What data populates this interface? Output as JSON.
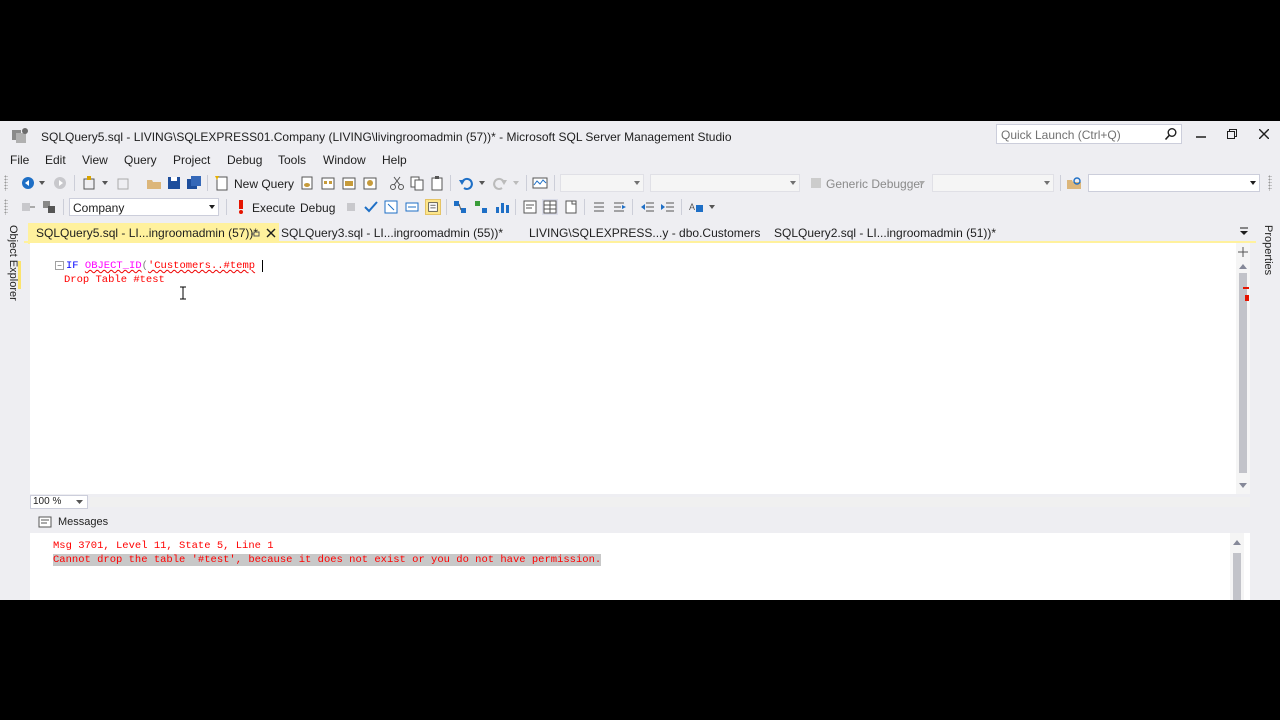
{
  "window": {
    "title": "SQLQuery5.sql - LIVING\\SQLEXPRESS01.Company (LIVING\\livingroomadmin (57))* - Microsoft SQL Server Management Studio",
    "quick_launch_placeholder": "Quick Launch (Ctrl+Q)"
  },
  "menu": [
    "File",
    "Edit",
    "View",
    "Query",
    "Project",
    "Debug",
    "Tools",
    "Window",
    "Help"
  ],
  "toolbar1": {
    "new_query_label": "New Query",
    "debugger_label": "Generic Debugger"
  },
  "toolbar2": {
    "database": "Company",
    "execute_label": "Execute",
    "debug_label": "Debug"
  },
  "side": {
    "left_tab": "Object Explorer",
    "right_tab": "Properties"
  },
  "tabs": [
    {
      "label": "SQLQuery5.sql - LI...ingroomadmin (57))*",
      "active": true
    },
    {
      "label": "SQLQuery3.sql - LI...ingroomadmin (55))*",
      "active": false
    },
    {
      "label": "LIVING\\SQLEXPRESS...y - dbo.Customers",
      "active": false
    },
    {
      "label": "SQLQuery2.sql - LI...ingroomadmin (51))*",
      "active": false
    }
  ],
  "editor": {
    "line1": {
      "kw": "IF ",
      "fn": "OBJECT_ID",
      "paren": "(",
      "str": "'Customers..#temp"
    },
    "line2": {
      "kw": "Drop Table ",
      "ident": "#test"
    },
    "zoom": "100 %"
  },
  "results": {
    "tab_label": "Messages",
    "msg1": "Msg 3701, Level 11, State 5, Line 1",
    "msg2": "Cannot drop the table '#test', because it does not exist or you do not have permission."
  },
  "colors": {
    "active_tab": "#fff19d",
    "chrome": "#eeeef2",
    "error_text": "#ff0000"
  }
}
